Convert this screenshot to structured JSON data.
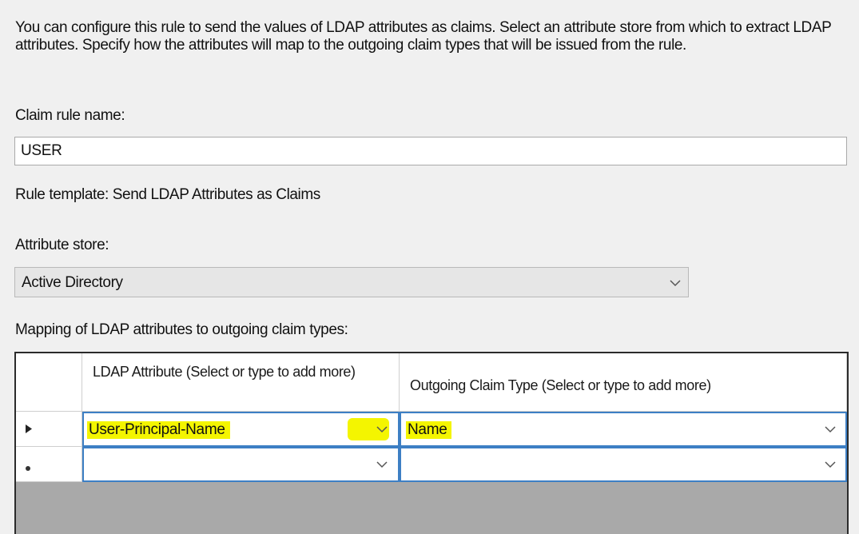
{
  "description": "You can configure this rule to send the values of LDAP attributes as claims. Select an attribute store from which to extract LDAP attributes. Specify how the attributes will map to the outgoing claim types that will be issued from the rule.",
  "claim_rule_name": {
    "label": "Claim rule name:",
    "value": "USER"
  },
  "rule_template": "Rule template: Send LDAP Attributes as Claims",
  "attribute_store": {
    "label": "Attribute store:",
    "selected": "Active Directory"
  },
  "mapping": {
    "label": "Mapping of LDAP attributes to outgoing claim types:",
    "columns": [
      "LDAP Attribute (Select or type to add more)",
      "Outgoing Claim Type (Select or type to add more)"
    ],
    "rows": [
      {
        "marker": "▶",
        "ldap_attribute": "User-Principal-Name",
        "claim_type": "Name"
      },
      {
        "marker": "*",
        "ldap_attribute": "",
        "claim_type": ""
      }
    ]
  },
  "highlight_color": "#f4f500",
  "icons": {
    "dropdown": "chevron-down-icon",
    "current_row": "row-pointer-icon",
    "new_row": "new-row-icon"
  }
}
